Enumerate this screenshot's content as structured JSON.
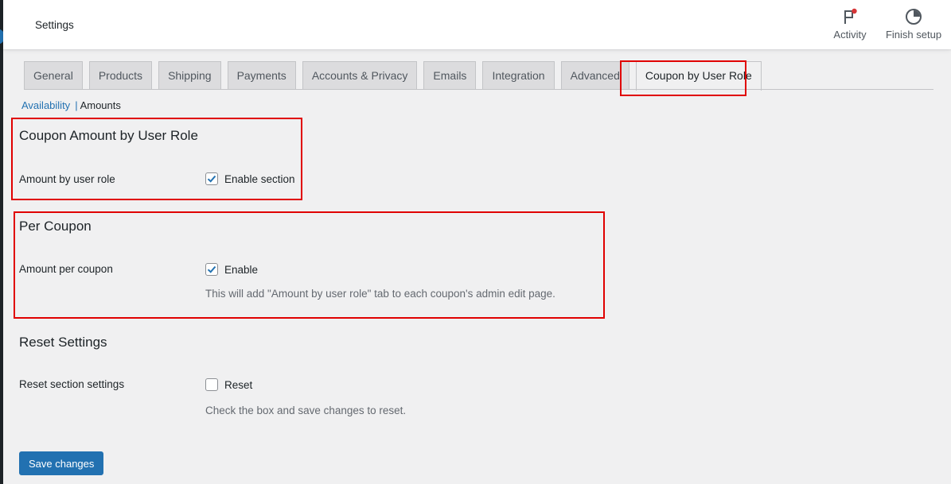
{
  "header": {
    "title": "Settings",
    "activity_label": "Activity",
    "finish_setup_label": "Finish setup"
  },
  "tabs": [
    {
      "label": "General"
    },
    {
      "label": "Products"
    },
    {
      "label": "Shipping"
    },
    {
      "label": "Payments"
    },
    {
      "label": "Accounts & Privacy"
    },
    {
      "label": "Emails"
    },
    {
      "label": "Integration"
    },
    {
      "label": "Advanced"
    },
    {
      "label": "Coupon by User Role",
      "active": true
    }
  ],
  "subnav": {
    "availability": "Availability",
    "separator": "|",
    "amounts": "Amounts"
  },
  "sections": {
    "amount_by_role": {
      "title": "Coupon Amount by User Role",
      "label": "Amount by user role",
      "checkbox_label": "Enable section",
      "checked": true
    },
    "per_coupon": {
      "title": "Per Coupon",
      "label": "Amount per coupon",
      "checkbox_label": "Enable",
      "checked": true,
      "description": "This will add \"Amount by user role\" tab to each coupon's admin edit page."
    },
    "reset": {
      "title": "Reset Settings",
      "label": "Reset section settings",
      "checkbox_label": "Reset",
      "checked": false,
      "description": "Check the box and save changes to reset."
    }
  },
  "save_button": "Save changes",
  "colors": {
    "accent": "#2271b1",
    "highlight": "#e00000",
    "notification_dot": "#d63638"
  }
}
